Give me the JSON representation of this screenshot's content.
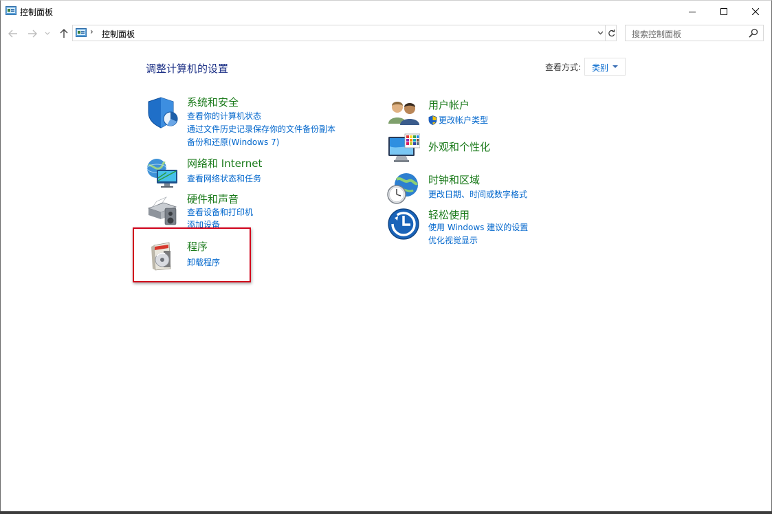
{
  "window": {
    "title": "控制面板"
  },
  "nav": {
    "back_icon": "arrow-left-icon",
    "forward_icon": "arrow-right-icon",
    "recent_icon": "chevron-down-icon",
    "up_icon": "arrow-up-icon"
  },
  "address": {
    "separator": "›",
    "path": "控制面板"
  },
  "search": {
    "placeholder": "搜索控制面板"
  },
  "main": {
    "heading": "调整计算机的设置",
    "viewby_label": "查看方式:",
    "viewby_value": "类别"
  },
  "categories": [
    {
      "title": "系统和安全",
      "links": [
        "查看你的计算机状态",
        "通过文件历史记录保存你的文件备份副本",
        "备份和还原(Windows 7)"
      ]
    },
    {
      "title": "网络和 Internet",
      "links": [
        "查看网络状态和任务"
      ]
    },
    {
      "title": "硬件和声音",
      "links": [
        "查看设备和打印机",
        "添加设备"
      ]
    },
    {
      "title": "程序",
      "links": [
        "卸载程序"
      ]
    },
    {
      "title": "用户帐户",
      "links": [
        "更改帐户类型"
      ]
    },
    {
      "title": "外观和个性化",
      "links": []
    },
    {
      "title": "时钟和区域",
      "links": [
        "更改日期、时间或数字格式"
      ]
    },
    {
      "title": "轻松使用",
      "links": [
        "使用 Windows 建议的设置",
        "优化视觉显示"
      ]
    }
  ],
  "colors": {
    "heading": "#1e3287",
    "category_title": "#1a7a1a",
    "link": "#0066cc",
    "highlight_box": "#d0021b"
  }
}
